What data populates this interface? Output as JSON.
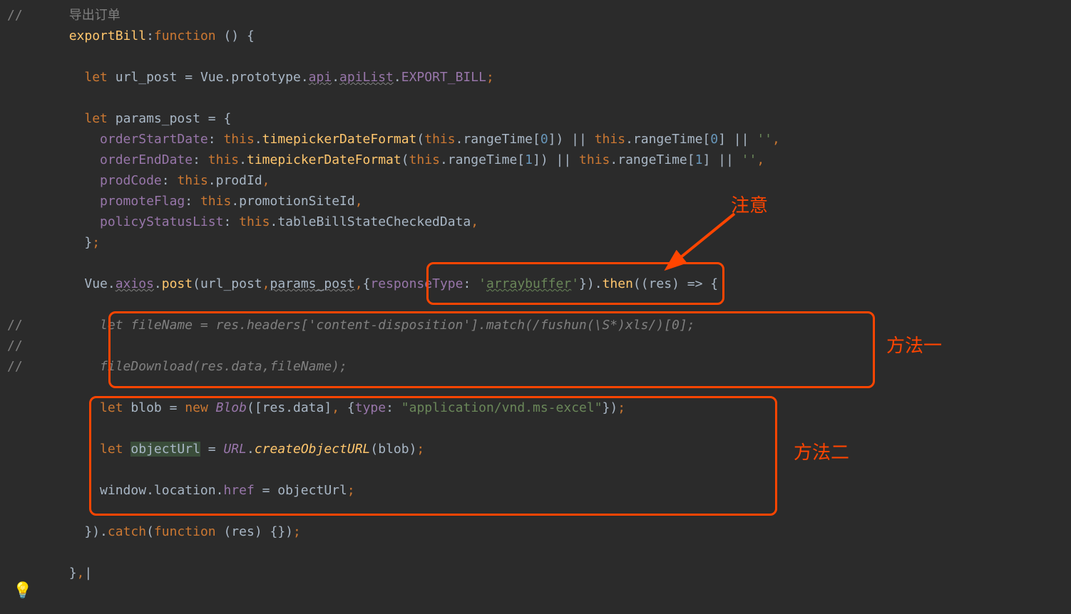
{
  "annotations": {
    "note_top": "注意",
    "method1": "方法一",
    "method2": "方法二"
  },
  "code": {
    "l1_a": "//      ",
    "l1_b": "导出订单",
    "l2_a": "        ",
    "l2_b": "exportBill",
    "l2_c": ":",
    "l2_d": "function ",
    "l2_e": "() {",
    "l3": "",
    "l4_a": "          ",
    "l4_b": "let ",
    "l4_c": "url_post ",
    "l4_d": "= Vue.prototype.",
    "l4_e": "api",
    "l4_f": ".",
    "l4_g": "apiList",
    "l4_h": ".",
    "l4_i": "EXPORT_BILL",
    "l4_j": ";",
    "l5": "",
    "l6_a": "          ",
    "l6_b": "let ",
    "l6_c": "params_post ",
    "l6_d": "= {",
    "l7_a": "            ",
    "l7_b": "orderStartDate",
    "l7_c": ": ",
    "l7_d": "this",
    "l7_e": ".",
    "l7_f": "timepickerDateFormat",
    "l7_g": "(",
    "l7_h": "this",
    "l7_i": ".rangeTime[",
    "l7_j": "0",
    "l7_k": "]) || ",
    "l7_l": "this",
    "l7_m": ".rangeTime[",
    "l7_n": "0",
    "l7_o": "] || ",
    "l7_p": "''",
    "l7_q": ",",
    "l8_a": "            ",
    "l8_b": "orderEndDate",
    "l8_c": ": ",
    "l8_d": "this",
    "l8_e": ".",
    "l8_f": "timepickerDateFormat",
    "l8_g": "(",
    "l8_h": "this",
    "l8_i": ".rangeTime[",
    "l8_j": "1",
    "l8_k": "]) || ",
    "l8_l": "this",
    "l8_m": ".rangeTime[",
    "l8_n": "1",
    "l8_o": "] || ",
    "l8_p": "''",
    "l8_q": ",",
    "l9_a": "            ",
    "l9_b": "prodCode",
    "l9_c": ": ",
    "l9_d": "this",
    "l9_e": ".prodId",
    "l9_f": ",",
    "l10_a": "            ",
    "l10_b": "promoteFlag",
    "l10_c": ": ",
    "l10_d": "this",
    "l10_e": ".promotionSiteId",
    "l10_f": ",",
    "l11_a": "            ",
    "l11_b": "policyStatusList",
    "l11_c": ": ",
    "l11_d": "this",
    "l11_e": ".tableBillStateCheckedData",
    "l11_f": ",",
    "l12_a": "          }",
    "l12_b": ";",
    "l13": "",
    "l14_a": "          Vue.",
    "l14_b": "axios",
    "l14_c": ".",
    "l14_d": "post",
    "l14_e": "(url_post",
    "l14_f": ",",
    "l14_g": "params_post",
    "l14_h": ",",
    "l14_i": "{",
    "l14_j": "responseType",
    "l14_k": ": ",
    "l14_l": "'",
    "l14_m": "arraybuffer",
    "l14_n": "'",
    "l14_o": "}).",
    "l14_p": "then",
    "l14_q": "((res) => {",
    "l15": "",
    "l16_a": "//          ",
    "l16_b": "let fileName = res.headers['content-disposition'].match(/fushun(\\S*)xls/)[0];",
    "l17_a": "//",
    "l18_a": "//          ",
    "l18_b": "fileDownload(res.data,fileName);",
    "l19": "",
    "l20_a": "            ",
    "l20_b": "let ",
    "l20_c": "blob = ",
    "l20_d": "new ",
    "l20_e": "Blob",
    "l20_f": "([res.data]",
    "l20_g": ", ",
    "l20_h": "{",
    "l20_i": "type",
    "l20_j": ": ",
    "l20_k": "\"application/vnd.ms-excel\"",
    "l20_l": "})",
    "l20_m": ";",
    "l21": "",
    "l22_a": "            ",
    "l22_b": "let ",
    "l22_c": "objectUrl",
    "l22_d": " = ",
    "l22_e": "URL",
    "l22_f": ".",
    "l22_g": "createObjectURL",
    "l22_h": "(blob)",
    "l22_i": ";",
    "l23": "",
    "l24_a": "            window.location.",
    "l24_b": "href ",
    "l24_c": "= objectUrl",
    "l24_d": ";",
    "l25": "",
    "l26_a": "          }).",
    "l26_b": "catch",
    "l26_c": "(",
    "l26_d": "function ",
    "l26_e": "(res) {})",
    "l26_f": ";",
    "l27": "",
    "l28_a": "        }",
    "l28_b": ",",
    "l28_c": "|"
  }
}
